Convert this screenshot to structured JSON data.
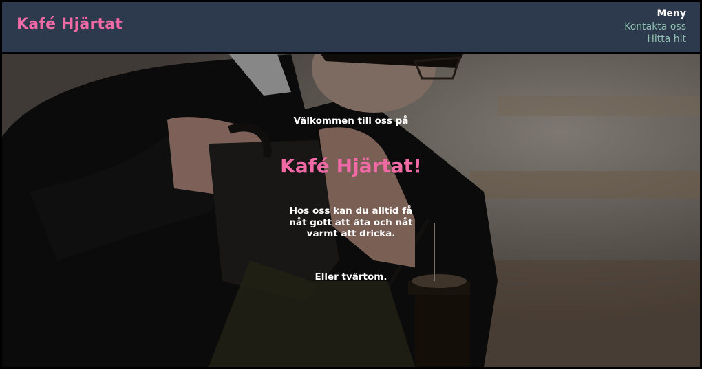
{
  "header": {
    "brand": "Kafé Hjärtat",
    "nav": {
      "title": "Meny",
      "links": [
        "Kontakta oss",
        "Hitta hit"
      ]
    }
  },
  "hero": {
    "welcome": "Välkommen till oss på",
    "title": "Kafé Hjärtat!",
    "description": "Hos oss kan du alltid få nåt gott att äta och nåt varmt att dricka.",
    "tagline": "Eller tvärtom."
  },
  "colors": {
    "header_bg": "#2d3a4d",
    "brand_pink": "#f06aa6",
    "nav_link": "#8fc1b0",
    "text_white": "#ffffff"
  },
  "icons": {
    "hero_image": "barista-pouring-coffee-photo"
  }
}
